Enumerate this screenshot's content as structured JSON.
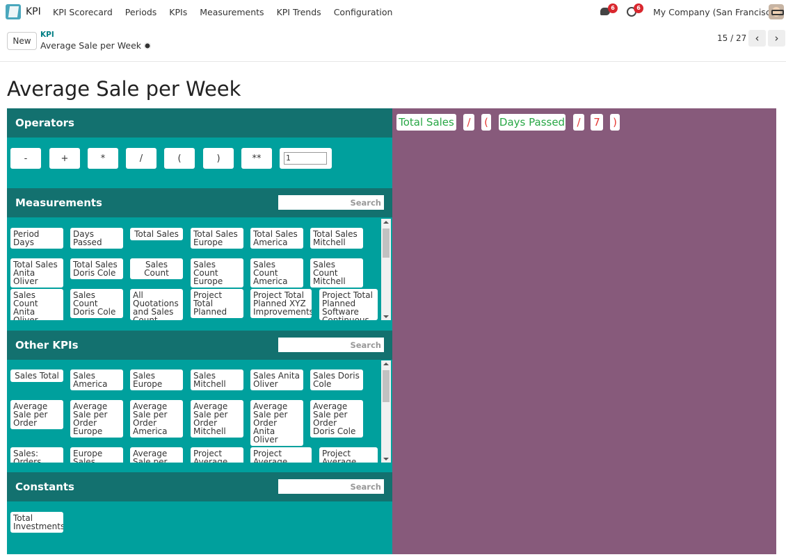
{
  "navbar": {
    "app_name": "KPI",
    "menu": [
      "KPI Scorecard",
      "Periods",
      "KPIs",
      "Measurements",
      "KPI Trends",
      "Configuration"
    ],
    "messages_count": "6",
    "activities_count": "6",
    "company": "My Company (San Francisco)"
  },
  "control": {
    "new_label": "New",
    "breadcrumb_parent": "KPI",
    "breadcrumb_current": "Average Sale per Week",
    "pager": "15 / 27",
    "prev": "‹",
    "next": "›"
  },
  "page": {
    "title": "Average Sale per Week"
  },
  "operators": {
    "heading": "Operators",
    "buttons": [
      "-",
      "+",
      "*",
      "/",
      "(",
      ")",
      "**"
    ],
    "input_value": "1"
  },
  "measurements": {
    "heading": "Measurements",
    "search_placeholder": "Search",
    "items": [
      "Period Days",
      "Days Passed",
      "Total Sales",
      "Total Sales Europe",
      "Total Sales America",
      "Total Sales Mitchell",
      "Total Sales Anita Oliver",
      "Total Sales Doris Cole",
      "Sales Count",
      "Sales Count Europe",
      "Sales Count America",
      "Sales Count Mitchell",
      "Sales Count Anita Oliver",
      "Sales Count Doris Cole",
      "All Quotations and Sales Count",
      "Project Total Planned",
      "Project Total Planned XYZ Improvements",
      "Project Total Planned Software Continuous"
    ]
  },
  "other_kpis": {
    "heading": "Other KPIs",
    "search_placeholder": "Search",
    "items": [
      "Sales Total",
      "Sales America",
      "Sales Europe",
      "Sales Mitchell",
      "Sales Anita Oliver",
      "Sales Doris Cole",
      "Average Sale per Order",
      "Average Sale per Order Europe",
      "Average Sale per Order America",
      "Average Sale per Order Mitchell",
      "Average Sale per Order Anita Oliver",
      "Average Sale per Order Doris Cole",
      "Sales: Orders",
      "Europe Sales Share",
      "Average Sale per",
      "Project Average",
      "Project Average Days",
      "Project Average Days"
    ]
  },
  "constants": {
    "heading": "Constants",
    "search_placeholder": "Search",
    "items": [
      "Total Investments"
    ]
  },
  "formula": {
    "tokens": [
      "Total Sales",
      "/",
      "(",
      "Days Passed",
      "/",
      "7",
      ")"
    ]
  },
  "colors": {
    "teal_panel": "#00a09d",
    "teal_header": "#13716f",
    "formula_panel": "#875a7b",
    "measurement_token": "#28a745",
    "operator_token": "#e53935",
    "badge": "#d9272e"
  }
}
